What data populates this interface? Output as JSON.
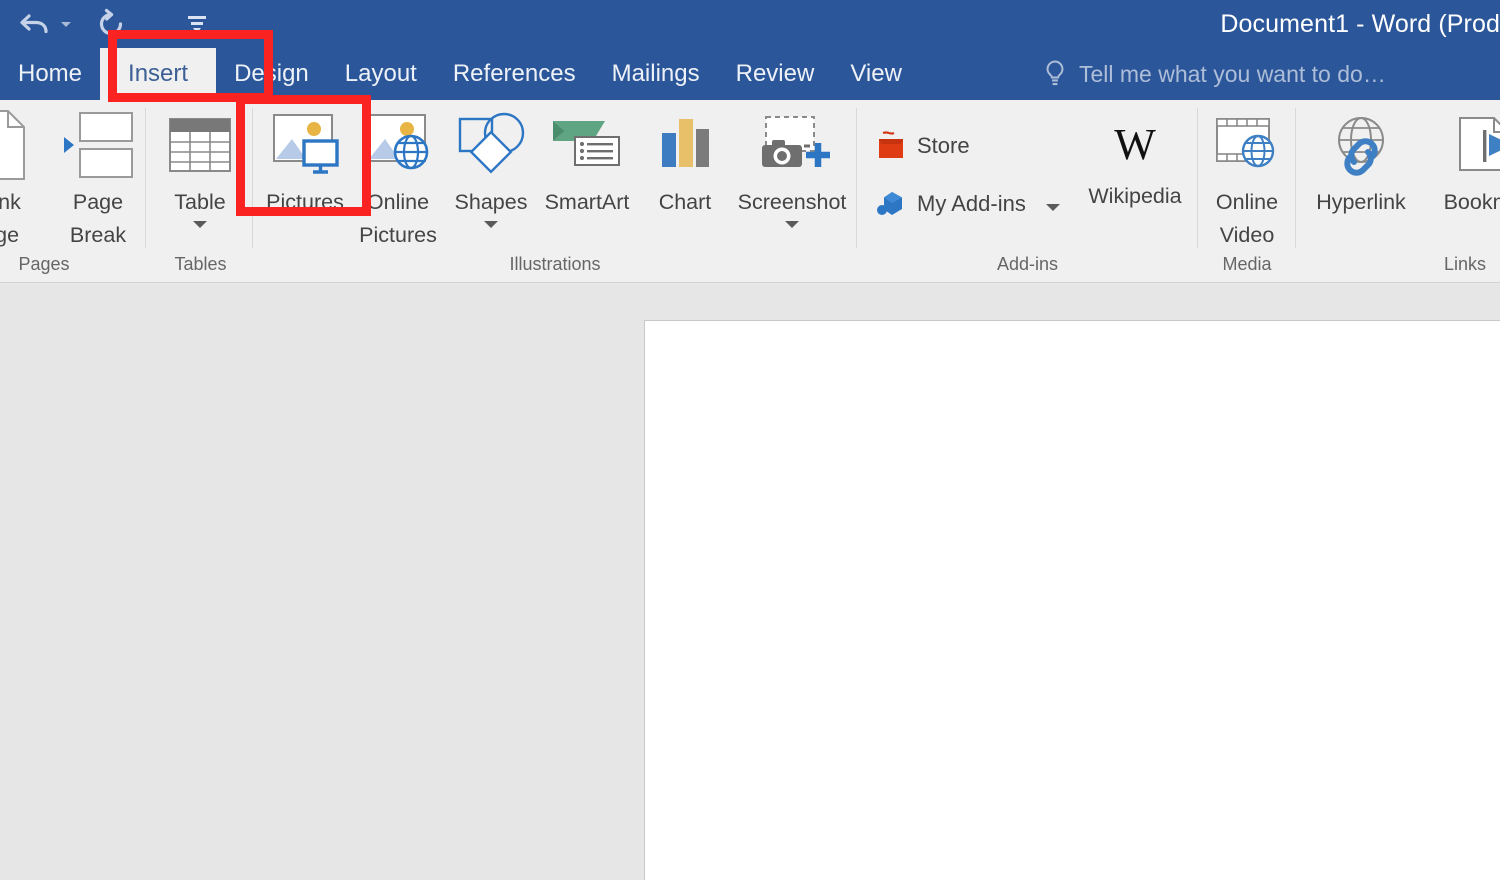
{
  "window": {
    "title": "Document1 - Word (Prod",
    "accent_color": "#2b579a",
    "ribbon_bg": "#f0f0f0",
    "highlight_color": "#fb2222"
  },
  "quick_access": {
    "undo": "undo-icon",
    "undo_dropdown": "chevron-down-icon",
    "redo": "redo-icon",
    "customize": "customize-quick-access-toolbar-icon"
  },
  "tabs": [
    {
      "label": "Home",
      "active": false
    },
    {
      "label": "Insert",
      "active": true
    },
    {
      "label": "Design",
      "active": false
    },
    {
      "label": "Layout",
      "active": false
    },
    {
      "label": "References",
      "active": false
    },
    {
      "label": "Mailings",
      "active": false
    },
    {
      "label": "Review",
      "active": false
    },
    {
      "label": "View",
      "active": false
    }
  ],
  "tell_me": {
    "icon": "lightbulb-icon",
    "placeholder": "Tell me what you want to do…"
  },
  "ribbon": {
    "groups": [
      {
        "name": "pages",
        "label": "Pages",
        "items": [
          {
            "name": "blank-page",
            "label": "Blank\nPage",
            "icon": "blank-page-icon"
          },
          {
            "name": "page-break",
            "label": "Page\nBreak",
            "icon": "page-break-icon"
          }
        ]
      },
      {
        "name": "tables",
        "label": "Tables",
        "items": [
          {
            "name": "table",
            "label": "Table",
            "icon": "table-icon",
            "has_dropdown": true
          }
        ]
      },
      {
        "name": "illustrations",
        "label": "Illustrations",
        "items": [
          {
            "name": "pictures",
            "label": "Pictures",
            "icon": "pictures-icon"
          },
          {
            "name": "online-pictures",
            "label": "Online\nPictures",
            "icon": "online-pictures-icon"
          },
          {
            "name": "shapes",
            "label": "Shapes",
            "icon": "shapes-icon",
            "has_dropdown": true
          },
          {
            "name": "smartart",
            "label": "SmartArt",
            "icon": "smartart-icon"
          },
          {
            "name": "chart",
            "label": "Chart",
            "icon": "chart-icon"
          },
          {
            "name": "screenshot",
            "label": "Screenshot",
            "icon": "screenshot-icon",
            "has_dropdown": true
          }
        ]
      },
      {
        "name": "add-ins",
        "label": "Add-ins",
        "items": [
          {
            "name": "store",
            "label": "Store",
            "icon": "store-icon"
          },
          {
            "name": "my-add-ins",
            "label": "My Add-ins",
            "icon": "my-add-ins-icon",
            "has_dropdown": true
          },
          {
            "name": "wikipedia",
            "label": "Wikipedia",
            "icon": "wikipedia-icon"
          }
        ]
      },
      {
        "name": "media",
        "label": "Media",
        "items": [
          {
            "name": "online-video",
            "label": "Online\nVideo",
            "icon": "online-video-icon"
          }
        ]
      },
      {
        "name": "links",
        "label": "Links",
        "items": [
          {
            "name": "hyperlink",
            "label": "Hyperlink",
            "icon": "hyperlink-icon"
          },
          {
            "name": "bookmark",
            "label": "Bookma",
            "icon": "bookmark-icon"
          }
        ]
      }
    ]
  },
  "document": {
    "page_background": "#ffffff",
    "canvas_background": "#e6e6e6"
  },
  "annotations": [
    {
      "name": "insert-tab-highlight",
      "target": "tab-insert"
    },
    {
      "name": "pictures-button-highlight",
      "target": "pictures-button"
    }
  ]
}
